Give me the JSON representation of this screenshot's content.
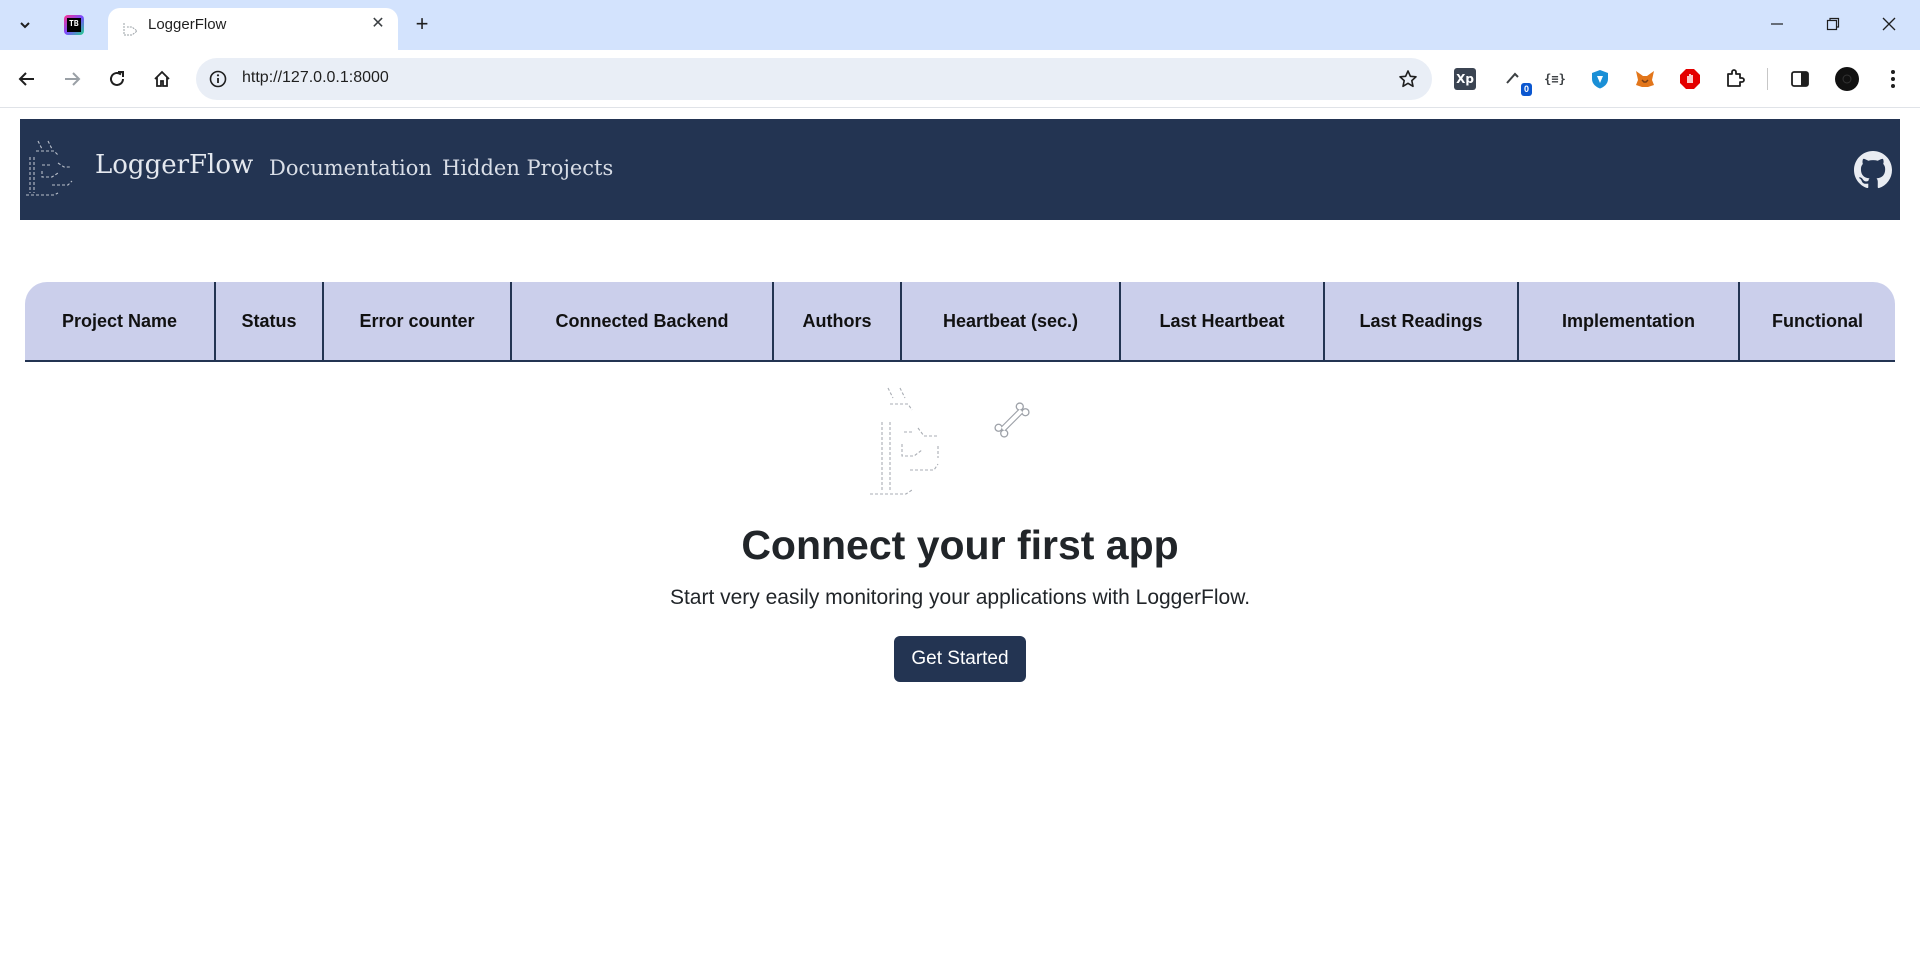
{
  "browser": {
    "tab_title": "LoggerFlow",
    "url": "http://127.0.0.1:8000",
    "pinned_tab_icon": "jetbrains-toolbox-icon",
    "extension_badge": "0",
    "extensions": [
      "xpath-icon",
      "sync-icon",
      "json-formatter-icon",
      "shield-icon",
      "metamask-icon",
      "adblock-icon",
      "puzzle-icon"
    ]
  },
  "navbar": {
    "brand": "LoggerFlow",
    "links": [
      "Documentation",
      "Hidden Projects"
    ],
    "background": "#233452"
  },
  "table": {
    "columns": [
      "Project Name",
      "Status",
      "Error counter",
      "Connected Backend",
      "Authors",
      "Heartbeat (sec.)",
      "Last Heartbeat",
      "Last Readings",
      "Implementation",
      "Functional"
    ],
    "header_background": "#cbcfeb",
    "rows": []
  },
  "empty_state": {
    "title": "Connect your first app",
    "subtitle": "Start very easily monitoring your applications with LoggerFlow.",
    "button_label": "Get Started"
  }
}
